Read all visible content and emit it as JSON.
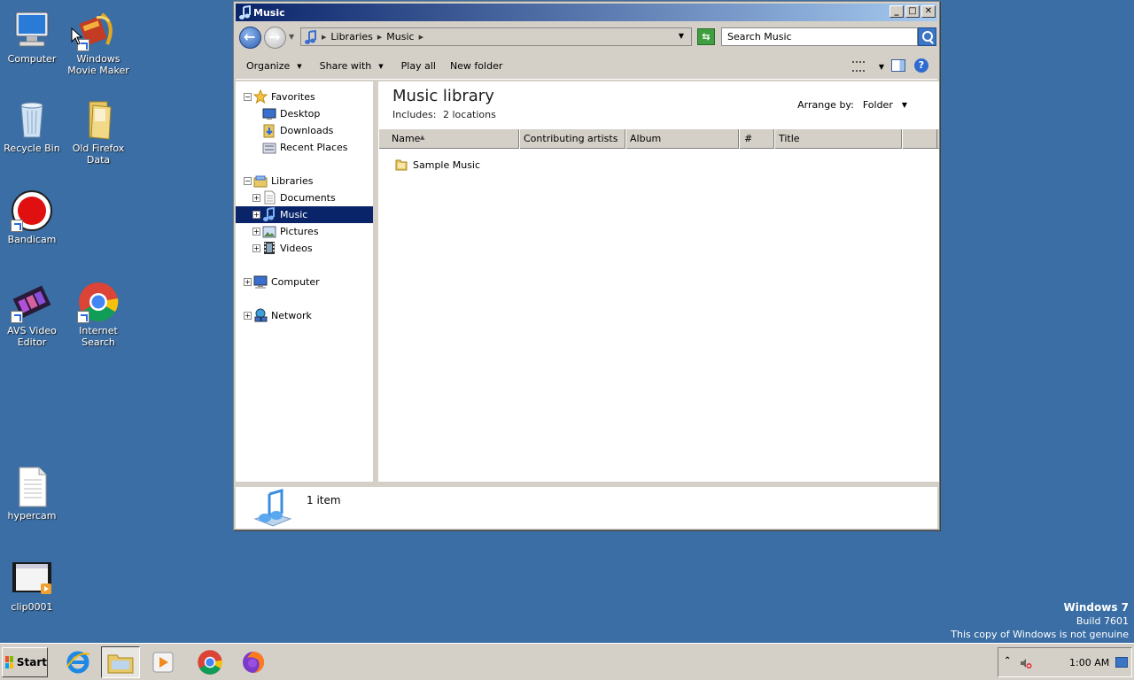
{
  "desktop": {
    "icons": [
      {
        "label": "Computer"
      },
      {
        "label": "Windows Movie Maker"
      },
      {
        "label": "Recycle Bin"
      },
      {
        "label": "Old Firefox Data"
      },
      {
        "label": "Bandicam"
      },
      {
        "label": "AVS Video Editor"
      },
      {
        "label": "Internet Search"
      },
      {
        "label": "hypercam"
      },
      {
        "label": "clip0001"
      }
    ],
    "background_color": "#3a6ea5"
  },
  "window": {
    "title": "Music",
    "address": {
      "crumbs": [
        "Libraries",
        "Music"
      ]
    },
    "search_placeholder": "Search Music",
    "toolbar": {
      "organize": "Organize",
      "share_with": "Share with",
      "play_all": "Play all",
      "new_folder": "New folder"
    },
    "nav": {
      "favorites": "Favorites",
      "desktop": "Desktop",
      "downloads": "Downloads",
      "recent_places": "Recent Places",
      "libraries": "Libraries",
      "documents": "Documents",
      "music": "Music",
      "pictures": "Pictures",
      "videos": "Videos",
      "computer": "Computer",
      "network": "Network"
    },
    "library": {
      "title": "Music library",
      "includes_label": "Includes:",
      "includes_value": "2 locations",
      "arrange_label": "Arrange by:",
      "arrange_value": "Folder"
    },
    "columns": [
      "Name",
      "Contributing artists",
      "Album",
      "#",
      "Title"
    ],
    "items": [
      {
        "name": "Sample Music"
      }
    ],
    "details": {
      "count": "1 item"
    }
  },
  "watermark": {
    "line1": "Windows 7",
    "line2": "Build 7601",
    "line3": "This copy of Windows is not genuine"
  },
  "taskbar": {
    "start_label": "Start",
    "clock": "1:00 AM"
  }
}
